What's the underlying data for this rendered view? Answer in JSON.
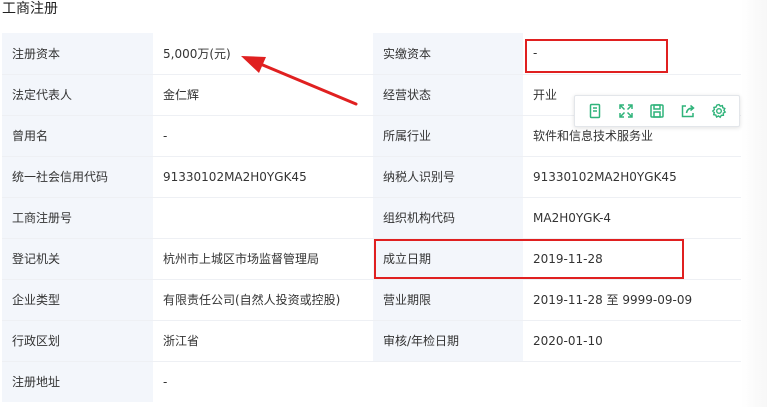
{
  "section": {
    "title": "工商注册"
  },
  "rows": [
    [
      {
        "label": "注册资本",
        "value": "5,000万(元)"
      },
      {
        "label": "实缴资本",
        "value": "-"
      }
    ],
    [
      {
        "label": "法定代表人",
        "value": "金仁辉"
      },
      {
        "label": "经营状态",
        "value": "开业"
      }
    ],
    [
      {
        "label": "曾用名",
        "value": "-"
      },
      {
        "label": "所属行业",
        "value": "软件和信息技术服务业"
      }
    ],
    [
      {
        "label": "统一社会信用代码",
        "value": "91330102MA2H0YGK45"
      },
      {
        "label": "纳税人识别号",
        "value": "91330102MA2H0YGK45"
      }
    ],
    [
      {
        "label": "工商注册号",
        "value": ""
      },
      {
        "label": "组织机构代码",
        "value": "MA2H0YGK-4"
      }
    ],
    [
      {
        "label": "登记机关",
        "value": "杭州市上城区市场监督管理局"
      },
      {
        "label": "成立日期",
        "value": "2019-11-28"
      }
    ],
    [
      {
        "label": "企业类型",
        "value": "有限责任公司(自然人投资或控股)"
      },
      {
        "label": "营业期限",
        "value": "2019-11-28 至 9999-09-09"
      }
    ],
    [
      {
        "label": "行政区划",
        "value": "浙江省"
      },
      {
        "label": "审核/年检日期",
        "value": "2020-01-10"
      }
    ],
    [
      {
        "label": "注册地址",
        "value": "-"
      }
    ]
  ],
  "toolbar": {
    "icons": [
      "copy-icon",
      "expand-icon",
      "save-icon",
      "share-icon",
      "settings-icon"
    ],
    "color": "#2fb37a"
  },
  "annotations": {
    "color": "#e02020"
  }
}
